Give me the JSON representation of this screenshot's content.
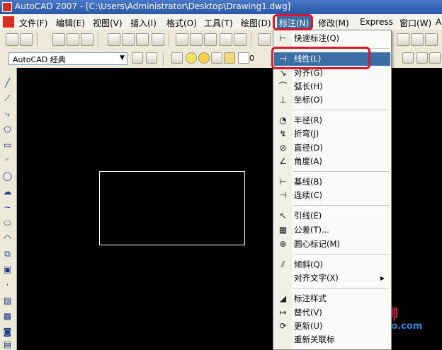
{
  "window": {
    "title": "AutoCAD 2007 - [C:\\Users\\Administrator\\Desktop\\Drawing1.dwg]"
  },
  "menubar": {
    "items": [
      "文件(F)",
      "编辑(E)",
      "视图(V)",
      "插入(I)",
      "格式(O)",
      "工具(T)",
      "绘图(D)",
      "标注(N)",
      "修改(M)",
      "Express",
      "窗口(W)",
      "A"
    ],
    "active_index": 7
  },
  "workspace": {
    "selected": "AutoCAD 经典",
    "layer_value": "0"
  },
  "dimension_menu": {
    "items": [
      {
        "label": "快速标注(Q)",
        "icon": "quick-dimension-icon",
        "symbol": "⊢"
      },
      {
        "label": "线性(L)",
        "icon": "linear-dimension-icon",
        "symbol": "⊣",
        "highlighted": true
      },
      {
        "label": "对齐(G)",
        "icon": "aligned-dimension-icon",
        "symbol": "↘"
      },
      {
        "label": "弧长(H)",
        "icon": "arc-length-icon",
        "symbol": "⌒"
      },
      {
        "label": "坐标(O)",
        "icon": "ordinate-icon",
        "symbol": "⊥"
      },
      {
        "label": "半径(R)",
        "icon": "radius-icon",
        "symbol": "◔"
      },
      {
        "label": "折弯(J)",
        "icon": "jogged-icon",
        "symbol": "↯"
      },
      {
        "label": "直径(D)",
        "icon": "diameter-icon",
        "symbol": "⊘"
      },
      {
        "label": "角度(A)",
        "icon": "angular-icon",
        "symbol": "∠"
      },
      {
        "label": "基线(B)",
        "icon": "baseline-icon",
        "symbol": "⊢"
      },
      {
        "label": "连续(C)",
        "icon": "continue-icon",
        "symbol": "⊣"
      },
      {
        "label": "引线(E)",
        "icon": "leader-icon",
        "symbol": "↖"
      },
      {
        "label": "公差(T)...",
        "icon": "tolerance-icon",
        "symbol": "▦"
      },
      {
        "label": "圆心标记(M)",
        "icon": "center-mark-icon",
        "symbol": "⊕"
      },
      {
        "label": "倾斜(Q)",
        "icon": "oblique-icon",
        "symbol": "⫽"
      },
      {
        "label": "对齐文字(X)",
        "icon": "",
        "symbol": "",
        "submenu": true
      },
      {
        "label": "标注样式",
        "icon": "dimension-style-icon",
        "symbol": "◢"
      },
      {
        "label": "替代(V)",
        "icon": "override-icon",
        "symbol": "↦"
      },
      {
        "label": "更新(U)",
        "icon": "update-icon",
        "symbol": "⟳"
      },
      {
        "label": "重新关联标",
        "icon": "",
        "symbol": ""
      }
    ]
  },
  "watermark": {
    "text": "爱尬聊",
    "sub": "igaliao.com"
  },
  "colors": {
    "title_bar": "#2a58a8",
    "menu_highlight": "#3a6ea5",
    "callout": "#d8182a",
    "canvas": "#000000"
  }
}
